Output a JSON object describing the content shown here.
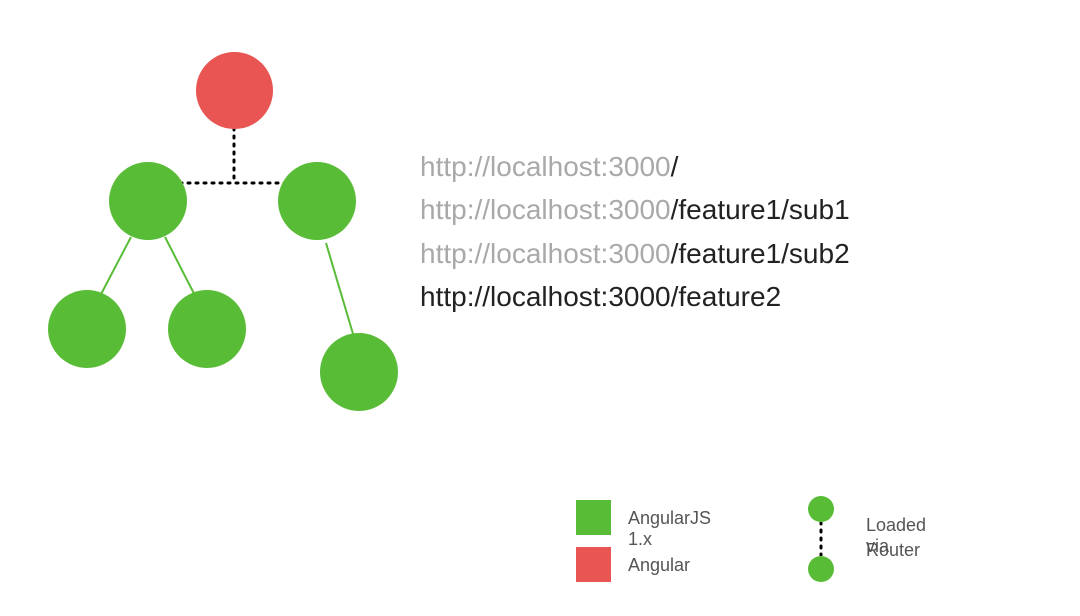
{
  "colors": {
    "green": "#59bc37",
    "red": "#e85552",
    "light_text": "#a9a9a9",
    "dark_text": "#222222"
  },
  "diagram": {
    "nodes": [
      {
        "id": "root",
        "kind": "angular",
        "color": "red"
      },
      {
        "id": "left",
        "kind": "angularjs",
        "color": "green"
      },
      {
        "id": "right",
        "kind": "angularjs",
        "color": "green"
      },
      {
        "id": "left-a",
        "kind": "angularjs",
        "color": "green"
      },
      {
        "id": "left-b",
        "kind": "angularjs",
        "color": "green"
      },
      {
        "id": "right-a",
        "kind": "angularjs",
        "color": "green"
      }
    ],
    "edges": [
      {
        "from": "root",
        "to": "left",
        "style": "dotted"
      },
      {
        "from": "root",
        "to": "right",
        "style": "dotted"
      },
      {
        "from": "left",
        "to": "left-a",
        "style": "solid"
      },
      {
        "from": "left",
        "to": "left-b",
        "style": "solid"
      },
      {
        "from": "right",
        "to": "right-a",
        "style": "solid"
      }
    ]
  },
  "routes": [
    {
      "base": "http://localhost:3000",
      "path": "/",
      "emphasis": "path"
    },
    {
      "base": "http://localhost:3000",
      "path": "/feature1/sub1",
      "emphasis": "path"
    },
    {
      "base": "http://localhost:3000",
      "path": "/feature1/sub2",
      "emphasis": "path"
    },
    {
      "base": "http://localhost:3000",
      "path": "/feature2",
      "emphasis": "all"
    }
  ],
  "legend": {
    "green_label": "AngularJS 1.x",
    "red_label": "Angular",
    "router_line1": "Loaded via",
    "router_line2": "Router"
  }
}
